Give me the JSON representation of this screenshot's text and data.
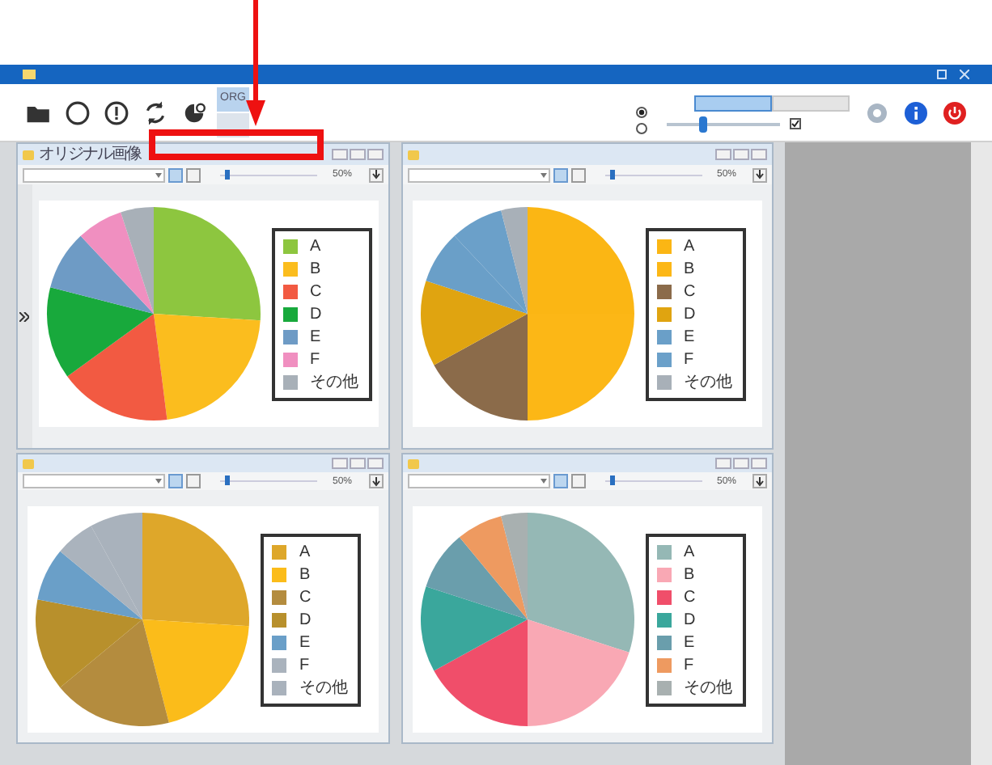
{
  "toolbar": {
    "mode_buttons": [
      {
        "label": "ORG",
        "selected": true
      }
    ],
    "radios": [
      {
        "selected": true
      },
      {
        "selected": false
      }
    ],
    "segments": [
      {
        "selected": true
      },
      {
        "selected": false
      }
    ],
    "slider": {
      "level": 0.3
    },
    "checkbox": {
      "checked": true
    }
  },
  "panels": [
    {
      "title": "オリジナル画像",
      "zoom": "50%",
      "legend": [
        {
          "label": "A",
          "color": "#8dc63f"
        },
        {
          "label": "B",
          "color": "#fbbd1e"
        },
        {
          "label": "C",
          "color": "#f25a42"
        },
        {
          "label": "D",
          "color": "#18a93c"
        },
        {
          "label": "E",
          "color": "#6e9bc5"
        },
        {
          "label": "F",
          "color": "#f08fc0"
        },
        {
          "label": "その他",
          "color": "#a8b0b8"
        }
      ]
    },
    {
      "zoom": "50%",
      "legend": [
        {
          "label": "A",
          "color": "#fbb614"
        },
        {
          "label": "B",
          "color": "#fcb716"
        },
        {
          "label": "C",
          "color": "#8b6b4a"
        },
        {
          "label": "D",
          "color": "#e0a410"
        },
        {
          "label": "E",
          "color": "#6a9fc8"
        },
        {
          "label": "F",
          "color": "#6ba0c9"
        },
        {
          "label": "その他",
          "color": "#a8b0b8"
        }
      ]
    },
    {
      "zoom": "50%",
      "legend": [
        {
          "label": "A",
          "color": "#dea72a"
        },
        {
          "label": "B",
          "color": "#fbbc1a"
        },
        {
          "label": "C",
          "color": "#b48c3e"
        },
        {
          "label": "D",
          "color": "#b8902c"
        },
        {
          "label": "E",
          "color": "#6a9fc8"
        },
        {
          "label": "F",
          "color": "#aab3bd"
        },
        {
          "label": "その他",
          "color": "#a9b2bc"
        }
      ]
    },
    {
      "zoom": "50%",
      "legend": [
        {
          "label": "A",
          "color": "#95b8b5"
        },
        {
          "label": "B",
          "color": "#f9a8b4"
        },
        {
          "label": "C",
          "color": "#f04e6a"
        },
        {
          "label": "D",
          "color": "#3aa79c"
        },
        {
          "label": "E",
          "color": "#6a9eac"
        },
        {
          "label": "F",
          "color": "#ee9a60"
        },
        {
          "label": "その他",
          "color": "#a8b0b0"
        }
      ]
    }
  ]
}
